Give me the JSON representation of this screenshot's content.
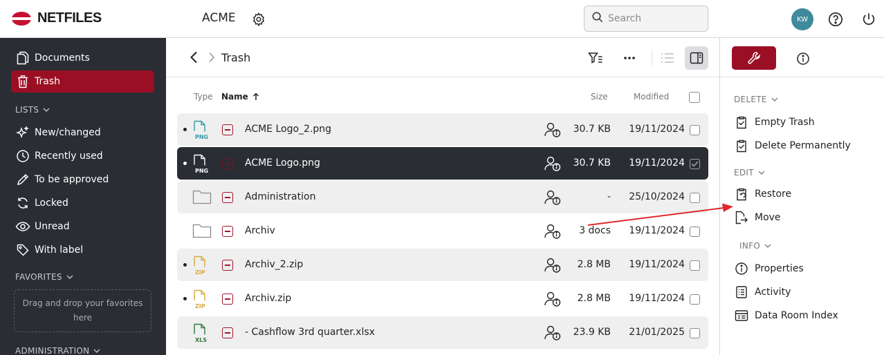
{
  "app": {
    "brand": "NETFILES",
    "room": "ACME"
  },
  "search": {
    "placeholder": "Search"
  },
  "user": {
    "initials": "KW"
  },
  "sidebar": {
    "items": [
      {
        "label": "Documents",
        "icon": "documents-icon"
      },
      {
        "label": "Trash",
        "icon": "trash-icon",
        "active": true
      }
    ],
    "lists_label": "LISTS",
    "lists": [
      {
        "label": "New/changed",
        "icon": "sparkle-icon"
      },
      {
        "label": "Recently used",
        "icon": "clock-icon"
      },
      {
        "label": "To be approved",
        "icon": "pencil-icon"
      },
      {
        "label": "Locked",
        "icon": "refresh-icon"
      },
      {
        "label": "Unread",
        "icon": "eye-icon"
      },
      {
        "label": "With label",
        "icon": "tag-icon"
      }
    ],
    "favorites_label": "FAVORITES",
    "favorites_drop": "Drag and drop your favorites here",
    "administration_label": "ADMINISTRATION"
  },
  "main": {
    "breadcrumb": "Trash",
    "columns": {
      "type": "Type",
      "name": "Name",
      "size": "Size",
      "modified": "Modified"
    },
    "rows": [
      {
        "type": "png",
        "name": "ACME Logo_2.png",
        "size": "30.7 KB",
        "modified": "19/11/2024",
        "dot": true
      },
      {
        "type": "png",
        "name": "ACME Logo.png",
        "size": "30.7 KB",
        "modified": "19/11/2024",
        "dot": true,
        "selected": true
      },
      {
        "type": "folder",
        "name": "Administration",
        "size": "-",
        "modified": "25/10/2024",
        "dot": false
      },
      {
        "type": "folder",
        "name": "Archiv",
        "size": "3 docs",
        "modified": "19/11/2024",
        "dot": false
      },
      {
        "type": "zip",
        "name": "Archiv_2.zip",
        "size": "2.8 MB",
        "modified": "19/11/2024",
        "dot": true
      },
      {
        "type": "zip",
        "name": "Archiv.zip",
        "size": "2.8 MB",
        "modified": "19/11/2024",
        "dot": true
      },
      {
        "type": "xls",
        "name": "- Cashflow 3rd quarter.xlsx",
        "size": "23.9 KB",
        "modified": "21/01/2025",
        "dot": false
      }
    ],
    "file_badges": {
      "png": "PNG",
      "zip": "ZIP",
      "xls": "XLS"
    }
  },
  "panel": {
    "delete_label": "DELETE",
    "delete_items": [
      {
        "label": "Empty Trash",
        "icon": "clipboard-check-icon"
      },
      {
        "label": "Delete Permanently",
        "icon": "clipboard-check-icon"
      }
    ],
    "edit_label": "EDIT",
    "edit_items": [
      {
        "label": "Restore",
        "icon": "restore-icon"
      },
      {
        "label": "Move",
        "icon": "move-icon"
      }
    ],
    "info_label": "INFO",
    "info_items": [
      {
        "label": "Properties",
        "icon": "info-icon"
      },
      {
        "label": "Activity",
        "icon": "list-icon"
      },
      {
        "label": "Data Room Index",
        "icon": "index-icon"
      }
    ]
  },
  "colors": {
    "brand_red": "#9b0f24",
    "sidebar_bg": "#2a2d33",
    "avatar": "#3f8a9b",
    "png": "#2f9aa8",
    "zip": "#d8a93a",
    "xls": "#2f7a3c",
    "arrow": "#e0262b"
  }
}
